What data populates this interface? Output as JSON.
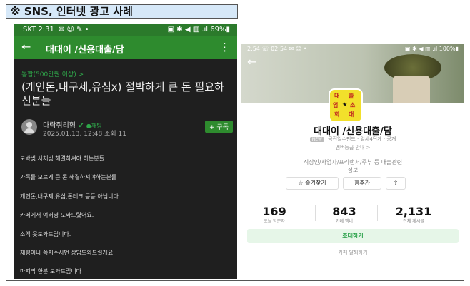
{
  "caption": "※ SNS, 인터넷 광고 사례",
  "left_phone": {
    "status_time": "SKT 2:31",
    "status_icons": "✉ ☺ ✎ •",
    "status_right": "▣ ✱ ◀ ▥ .ıl 69%▮",
    "back_icon": "←",
    "title": "대대이 /신용대출/담",
    "more_icon": "⋮",
    "board": "통합(500만원 이상) >",
    "headline": "(개인돈,내구제,유심x) 절박하게 큰 돈 필요하신분들",
    "author": "다람쥐리형",
    "author_check": "✔",
    "chat_label": "●채팅",
    "date": "2025.01.13. 12:48 조회 11",
    "subscribe": "+ 구독",
    "lines": [
      "도박빚 사채빚 해결하셔야 하는분들",
      "가족들 모르게 큰 돈 해결하셔야하는분들",
      "개인돈,내구제,유심,폰테크 등등 아닙니다.",
      "카페에서 여러명 도와드렸어요.",
      "소액 못도와드립니다.",
      "채팅이나 쪽지주시면 상담도와드릴게요",
      "마지막 한분 도와드립니다"
    ]
  },
  "right_phone": {
    "status_time": "2:54",
    "status_icons": "☏ 02:54 ✉ ☺ •",
    "status_right": "▣ ✱ ◀ ▥ .ıl 100%▮",
    "back_icon": "←",
    "logo_chars": [
      "대",
      "출",
      "업",
      "★",
      "소",
      "회",
      "대"
    ],
    "cafe_name": "대대이 /신용대출/담",
    "badge": "NEW",
    "meta": "금전일수펀드 · 일세4단계 · 공개",
    "member_grade": "멤버등급 안내 >",
    "desc_line1": "직장인/사업자/프리랜서/주부 등 대출관련",
    "desc_line2": "정보",
    "buttons": [
      "☆ 즐겨찾기",
      "홈추가",
      "⇪"
    ],
    "stats": [
      {
        "num": "169",
        "label": "오늘 방문자"
      },
      {
        "num": "843",
        "label": "카페 멤버"
      },
      {
        "num": "2,131",
        "label": "전체 게시글"
      }
    ],
    "invite": "초대하기",
    "leave": "카페 탈퇴하기"
  }
}
